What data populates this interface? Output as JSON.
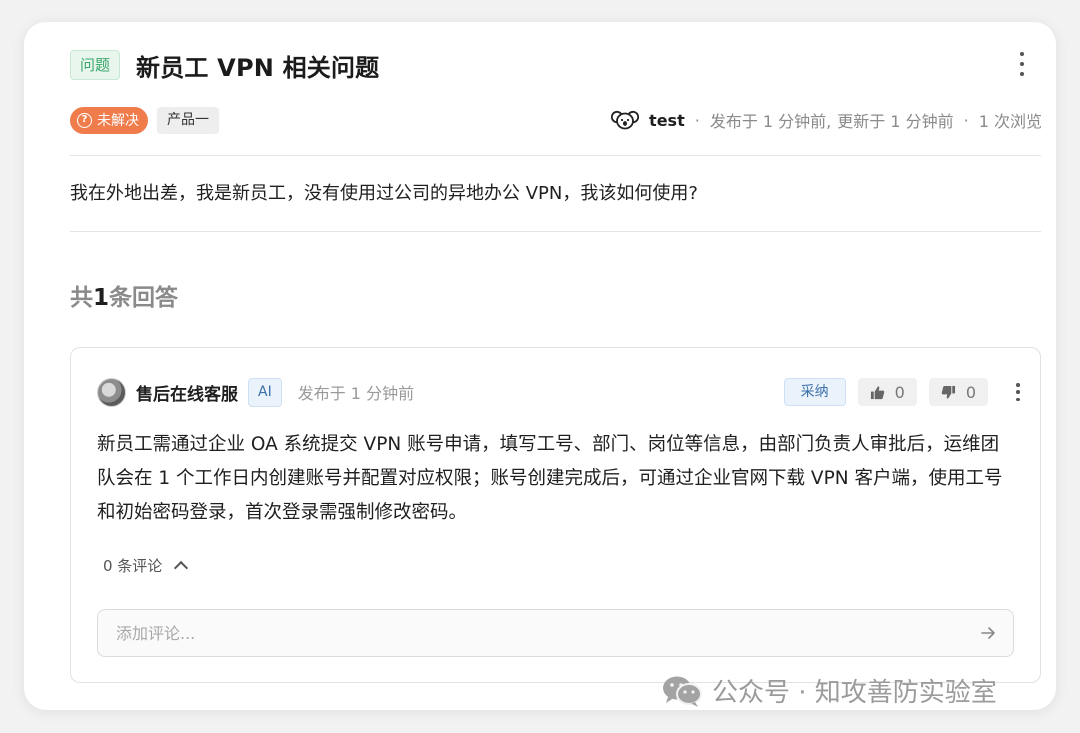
{
  "question": {
    "tag": "问题",
    "title": "新员工 VPN 相关问题",
    "status": "未解决",
    "product": "产品一",
    "author": "test",
    "published": "发布于 1 分钟前,",
    "updated": "更新于 1 分钟前",
    "views": "1 次浏览",
    "body": "我在外地出差，我是新员工，没有使用过公司的异地办公 VPN，我该如何使用?"
  },
  "answers_summary": {
    "prefix": "共",
    "count": "1",
    "suffix": "条回答"
  },
  "answer": {
    "author": "售后在线客服",
    "badge": "AI",
    "time": "发布于 1 分钟前",
    "accept_label": "采纳",
    "upvotes": "0",
    "downvotes": "0",
    "body": "新员工需通过企业 OA 系统提交 VPN 账号申请，填写工号、部门、岗位等信息，由部门负责人审批后，运维团队会在 1 个工作日内创建账号并配置对应权限；账号创建完成后，可通过企业官网下载 VPN 客户端，使用工号和初始密码登录，首次登录需强制修改密码。",
    "comments_label": "0 条评论",
    "comment_placeholder": "添加评论..."
  },
  "watermark": {
    "text": "公众号 · 知攻善防实验室"
  },
  "colors": {
    "status_badge": "#f07c4c",
    "question_tag": "#3aa56a",
    "accent_blue": "#3b6fa8"
  }
}
